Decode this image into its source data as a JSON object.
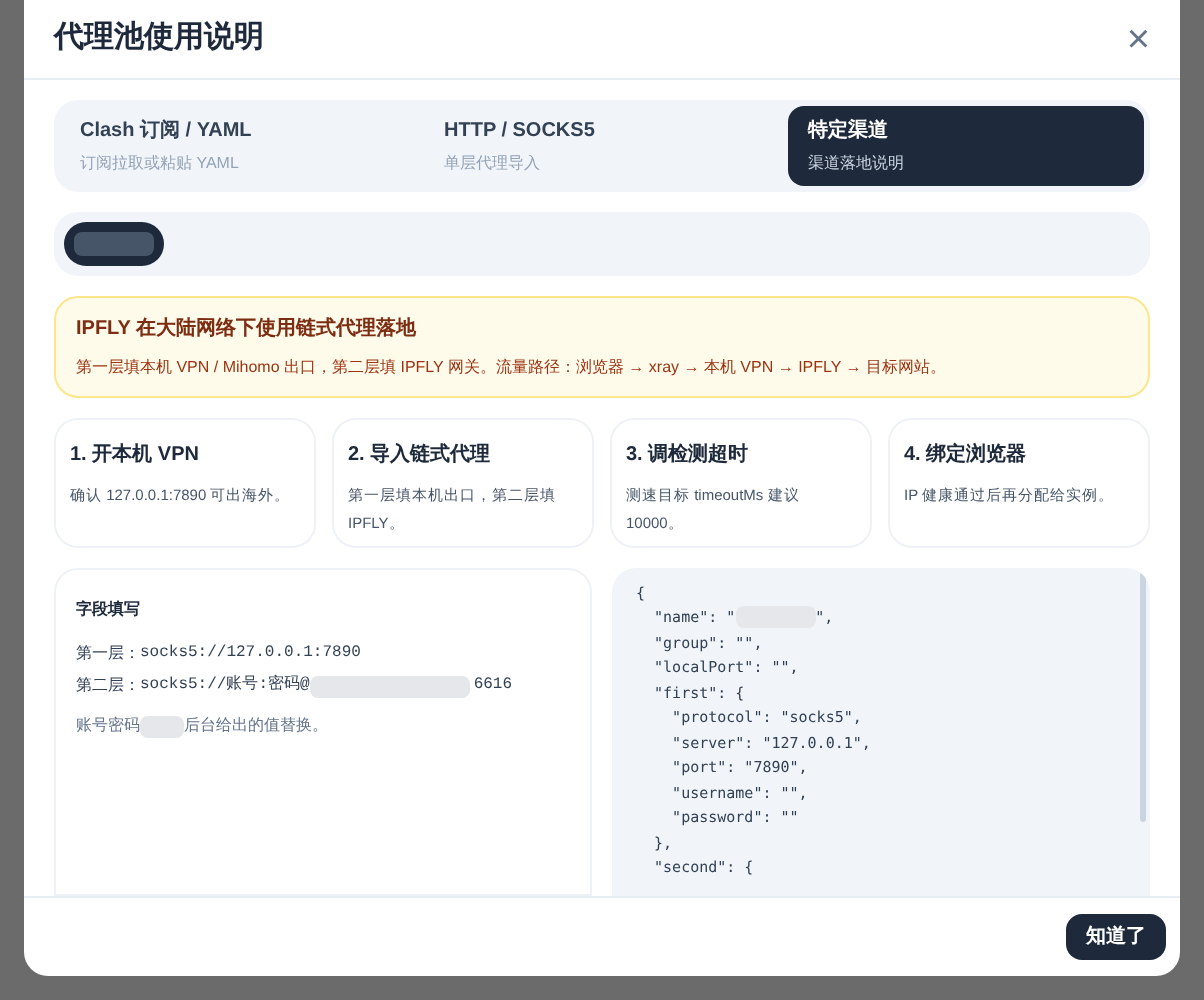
{
  "dialog": {
    "title": "代理池使用说明",
    "close": "×"
  },
  "tabs": [
    {
      "label": "Clash 订阅 / YAML",
      "sub": "订阅拉取或粘贴 YAML",
      "selected": false
    },
    {
      "label": "HTTP / SOCKS5",
      "sub": "单层代理导入",
      "selected": false
    },
    {
      "label": "特定渠道",
      "sub": "渠道落地说明",
      "selected": true
    }
  ],
  "notice": {
    "title": "IPFLY 在大陆网络下使用链式代理落地",
    "text": "第一层填本机 VPN / Mihomo 出口，第二层填 IPFLY 网关。流量路径：浏览器 → xray → 本机 VPN → IPFLY → 目标网站。"
  },
  "steps": [
    {
      "title": "1. 开本机 VPN",
      "text": "确认 127.0.0.1:7890 可出海外。"
    },
    {
      "title": "2. 导入链式代理",
      "text": "第一层填本机出口，第二层填 IPFLY。"
    },
    {
      "title": "3. 调检测超时",
      "text": "测速目标 timeoutMs 建议 10000。"
    },
    {
      "title": "4. 绑定浏览器",
      "text": "IP 健康通过后再分配给实例。"
    }
  ],
  "fields": {
    "title": "字段填写",
    "lines": [
      {
        "label": "第一层：",
        "value": "socks5://127.0.0.1:7890"
      },
      {
        "label": "第二层：",
        "value": "socks5://账号:密码@",
        "tail": "6616"
      }
    ],
    "note": {
      "text": "账号密码",
      "tail": "后台给出的值替换。"
    }
  },
  "code_lines": [
    {
      "text": "{"
    },
    {
      "text": "  \"name\": \"",
      "tail": "\","
    },
    {
      "text": "  \"group\": \"\","
    },
    {
      "text": "  \"localPort\": \"\","
    },
    {
      "text": "  \"first\": {"
    },
    {
      "text": "    \"protocol\": \"socks5\","
    },
    {
      "text": "    \"server\": \"127.0.0.1\","
    },
    {
      "text": "    \"port\": \"7890\","
    },
    {
      "text": "    \"username\": \"\","
    },
    {
      "text": "    \"password\": \"\""
    },
    {
      "text": "  },"
    },
    {
      "text": "  \"second\": {"
    }
  ],
  "footer": {
    "button": "知道了"
  }
}
